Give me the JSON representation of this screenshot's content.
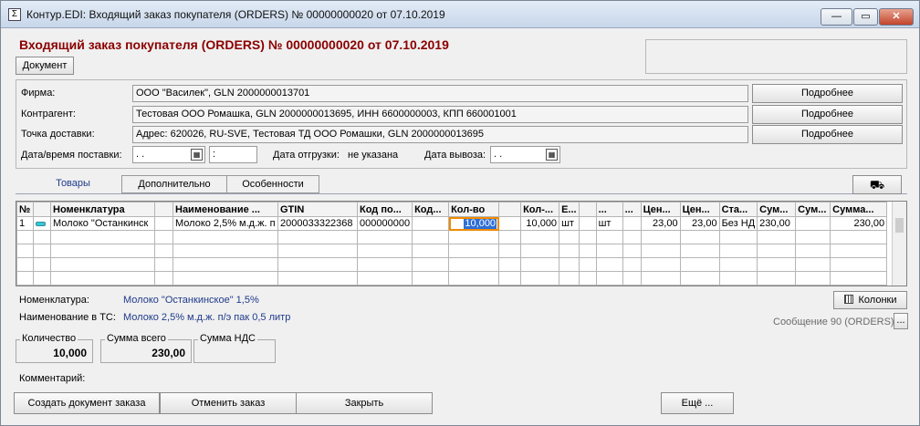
{
  "window": {
    "title": "Контур.EDI: Входящий заказ покупателя (ORDERS) № 00000000020 от 07.10.2019",
    "title_icon": "Σ"
  },
  "window_controls": {
    "minimize": "—",
    "maximize": "▭",
    "close": "✕"
  },
  "header": {
    "title": "Входящий заказ покупателя (ORDERS) № 00000000020 от 07.10.2019",
    "document_button": "Документ"
  },
  "details": {
    "firm_label": "Фирма:",
    "firm_value": "ООО \"Василек\", GLN 2000000013701",
    "counterparty_label": "Контрагент:",
    "counterparty_value": "Тестовая ООО Ромашка, GLN 2000000013695, ИНН 6600000003, КПП 660001001",
    "delivery_point_label": "Точка доставки:",
    "delivery_point_value": "Адрес: 620026, RU-SVE, Тестовая ТД ООО Ромашки, GLN 2000000013695",
    "more_button": "Подробнее",
    "delivery_datetime_label": "Дата/время поставки:",
    "delivery_date_value": " .  .",
    "delivery_time_value": " :",
    "shipment_date_label": "Дата отгрузки:",
    "shipment_date_value": "не указана",
    "pickup_date_label": "Дата вывоза:",
    "pickup_date_value": " .  ."
  },
  "tabs": [
    {
      "label": "Товары"
    },
    {
      "label": "Дополнительно"
    },
    {
      "label": "Особенности"
    }
  ],
  "table": {
    "columns": [
      "№",
      "",
      "Номенклатура",
      "",
      "Наименование ...",
      "GTIN",
      "Код по...",
      "Код...",
      "Кол-во",
      "",
      "Кол-...",
      "Е...",
      "",
      "...",
      "...",
      "Цен...",
      "Цен...",
      "Ста...",
      "Сум...",
      "Сум...",
      "Сумма..."
    ],
    "rows": [
      [
        "1",
        "",
        "Молоко \"Останкинск",
        "",
        "Молоко 2,5% м.д.ж. п",
        "2000033322368",
        "000000000",
        "",
        "10,000",
        "",
        "10,000",
        "шт",
        "",
        "шт",
        "",
        "23,00",
        "23,00",
        "Без НД",
        "230,00",
        "",
        "230,00"
      ]
    ]
  },
  "info": {
    "nomenclature_label": "Номенклатура:",
    "nomenclature_value": "Молоко \"Останкинское\" 1,5%",
    "ts_name_label": "Наименование в ТС:",
    "ts_name_value": "Молоко 2,5% м.д.ж. п/э пак 0,5 литр",
    "columns_button": "Колонки",
    "message_label": "Сообщение 90 (ORDERS)",
    "message_button": "..."
  },
  "totals": {
    "quantity_label": "Количество",
    "quantity_value": "10,000",
    "sum_label": "Сумма всего",
    "sum_value": "230,00",
    "vat_label": "Сумма НДС",
    "vat_value": ""
  },
  "comment_label": "Комментарий:",
  "footer": {
    "create_order": "Создать документ заказа",
    "cancel_order": "Отменить заказ",
    "close": "Закрыть",
    "more": "Ещё ..."
  },
  "colors": {
    "heading": "#8b0000",
    "link_blue": "#1f3a8a",
    "selection": "#2f6fd6",
    "focus": "#f08a00"
  }
}
